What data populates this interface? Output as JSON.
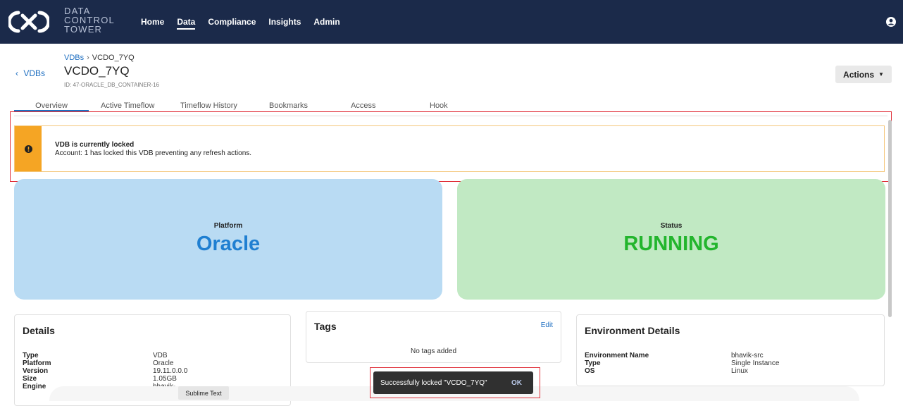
{
  "header": {
    "brand_line1": "DATA",
    "brand_line2": "CONTROL",
    "brand_line3": "TOWER",
    "nav": [
      "Home",
      "Data",
      "Compliance",
      "Insights",
      "Admin"
    ],
    "active_nav": "Data",
    "user_icon": "user-circle-icon"
  },
  "page": {
    "back_label": "VDBs",
    "breadcrumb_parent": "VDBs",
    "breadcrumb_current": "VCDO_7YQ",
    "title": "VCDO_7YQ",
    "id_text": "ID: 47-ORACLE_DB_CONTAINER-16",
    "actions_label": "Actions"
  },
  "tabs": [
    "Overview",
    "Active Timeflow",
    "Timeflow History",
    "Bookmarks",
    "Access",
    "Hook"
  ],
  "active_tab": "Overview",
  "lock_banner": {
    "title": "VDB is currently locked",
    "message": "Account: 1 has locked this VDB preventing any refresh actions.",
    "icon": "exclamation-circle-icon"
  },
  "platform_card": {
    "label": "Platform",
    "value": "Oracle",
    "bg": "#b9dbf3",
    "color": "#1f7fd1"
  },
  "status_card": {
    "label": "Status",
    "value": "RUNNING",
    "bg": "#c1e9c3",
    "color": "#23b52d"
  },
  "details": {
    "title": "Details",
    "rows": [
      {
        "k": "Type",
        "v": "VDB"
      },
      {
        "k": "Platform",
        "v": "Oracle"
      },
      {
        "k": "Version",
        "v": "19.11.0.0.0"
      },
      {
        "k": "Size",
        "v": "1.05GB"
      },
      {
        "k": "Engine",
        "v": "bhavik-"
      }
    ]
  },
  "tags": {
    "title": "Tags",
    "edit_label": "Edit",
    "empty_text": "No tags added"
  },
  "environment": {
    "title": "Environment Details",
    "rows": [
      {
        "k": "Environment Name",
        "v": "bhavik-src"
      },
      {
        "k": "Type",
        "v": "Single Instance"
      },
      {
        "k": "OS",
        "v": "Linux"
      }
    ]
  },
  "toast": {
    "message": "Successfully locked \"VCDO_7YQ\"",
    "ok_label": "OK"
  },
  "tooltip": "Sublime Text",
  "colors": {
    "topbar": "#1b2a4a",
    "link": "#1f6fc1",
    "highlight": "#e0303a",
    "warning": "#f5a524"
  }
}
